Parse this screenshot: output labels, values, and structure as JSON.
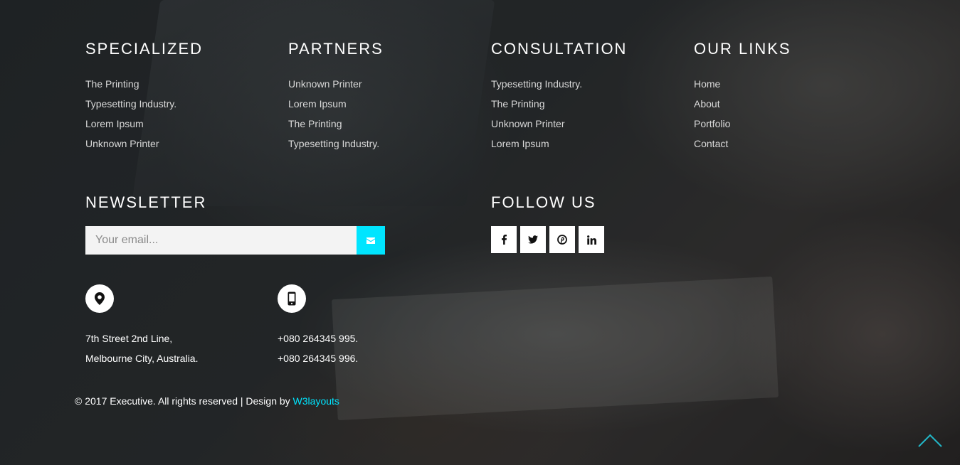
{
  "columns": [
    {
      "heading": "SPECIALIZED",
      "items": [
        "The Printing",
        "Typesetting Industry.",
        "Lorem Ipsum",
        "Unknown Printer"
      ]
    },
    {
      "heading": "PARTNERS",
      "items": [
        "Unknown Printer",
        "Lorem Ipsum",
        "The Printing",
        "Typesetting Industry."
      ]
    },
    {
      "heading": "CONSULTATION",
      "items": [
        "Typesetting Industry.",
        "The Printing",
        "Unknown Printer",
        "Lorem Ipsum"
      ]
    },
    {
      "heading": "OUR LINKS",
      "items": [
        "Home",
        "About",
        "Portfolio",
        "Contact"
      ]
    }
  ],
  "newsletter": {
    "heading": "NEWSLETTER",
    "placeholder": "Your email...",
    "submit_icon": "envelope-icon"
  },
  "follow": {
    "heading": "FOLLOW US",
    "networks": [
      "facebook-icon",
      "twitter-icon",
      "pinterest-icon",
      "linkedin-icon"
    ]
  },
  "contact": {
    "address_icon": "map-marker-icon",
    "address": [
      "7th Street 2nd Line,",
      "Melbourne City, Australia."
    ],
    "phone_icon": "mobile-phone-icon",
    "phones": [
      "+080 264345 995.",
      "+080 264345 996."
    ]
  },
  "footer": {
    "copyright": "© 2017 Executive. All rights reserved | Design by ",
    "brand": "W3layouts"
  },
  "colors": {
    "accent": "#00e5ff",
    "text_muted": "#d9d9d9",
    "input_bg": "#f3f3f3"
  },
  "scroll_top_icon": "chevron-up-icon"
}
